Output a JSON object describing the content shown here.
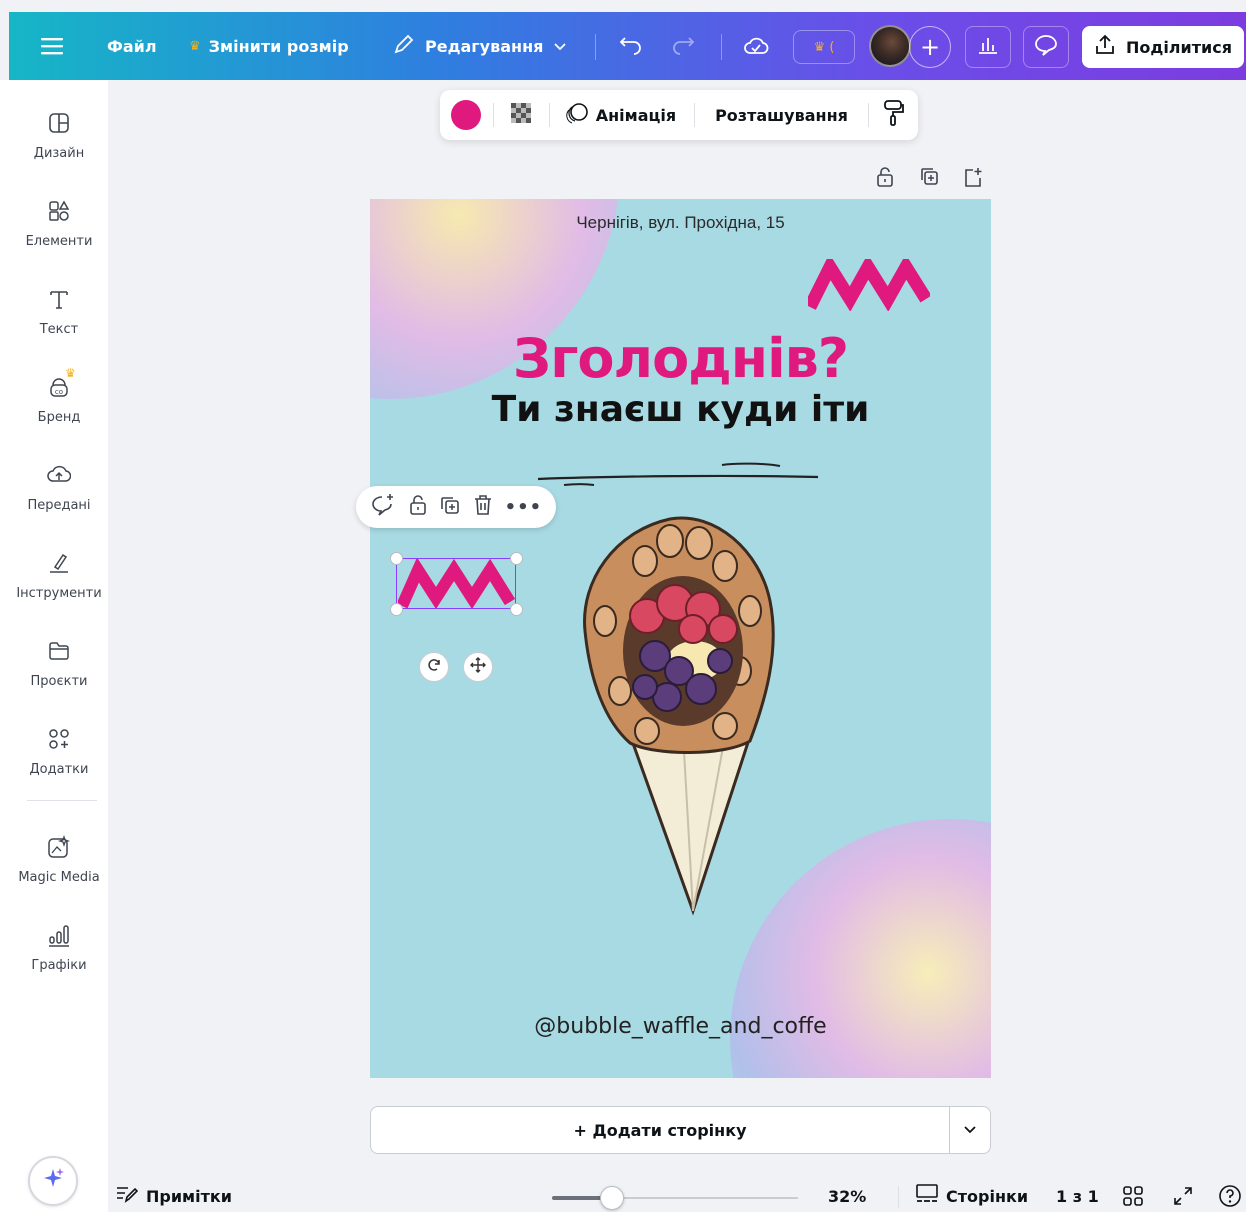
{
  "topbar": {
    "file_label": "Файл",
    "resize_label": "Змінити розмір",
    "editing_label": "Редагування",
    "share_label": "Поділитися",
    "crown_color": "#f2b11c"
  },
  "sidebar": {
    "items": [
      {
        "label": "Дизайн",
        "icon": "layout-icon"
      },
      {
        "label": "Елементи",
        "icon": "shapes-icon"
      },
      {
        "label": "Текст",
        "icon": "text-icon"
      },
      {
        "label": "Бренд",
        "icon": "brand-icon"
      },
      {
        "label": "Передані",
        "icon": "upload-cloud-icon"
      },
      {
        "label": "Інструменти",
        "icon": "draw-icon"
      },
      {
        "label": "Проєкти",
        "icon": "folder-icon"
      },
      {
        "label": "Додатки",
        "icon": "apps-icon"
      },
      {
        "label": "Magic Media",
        "icon": "magic-media-icon"
      },
      {
        "label": "Графіки",
        "icon": "charts-icon"
      }
    ]
  },
  "float_toolbar": {
    "color": "#e0197e",
    "animation_label": "Анімація",
    "position_label": "Розташування"
  },
  "design": {
    "address": "Чернігів, вул. Прохідна, 15",
    "headline": "Зголоднів?",
    "subline": "Ти знаєш куди іти",
    "handle": "@bubble_waffle_and_coffe",
    "background_color": "#a8dae3",
    "accent_color": "#e0197e"
  },
  "add_page": {
    "label": "+ Додати сторінку"
  },
  "bottombar": {
    "notes_label": "Примітки",
    "zoom": "32%",
    "zoom_value": 0.32,
    "pages_label": "Сторінки",
    "page_counter": "1 з 1"
  }
}
